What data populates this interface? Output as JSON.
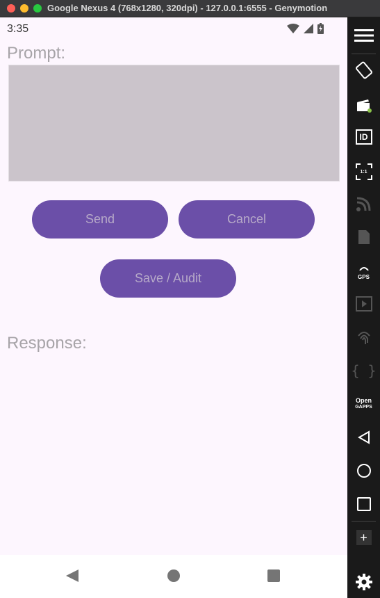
{
  "window": {
    "title": "Google Nexus 4 (768x1280, 320dpi) - 127.0.0.1:6555 - Genymotion"
  },
  "status_bar": {
    "time": "3:35"
  },
  "prompt": {
    "label": "Prompt:",
    "value": ""
  },
  "buttons": {
    "send": "Send",
    "cancel": "Cancel",
    "save_audit": "Save / Audit"
  },
  "response": {
    "label": "Response:",
    "value": ""
  },
  "sidebar": {
    "items": [
      {
        "icon": "menu-icon"
      },
      {
        "icon": "rotate-icon"
      },
      {
        "icon": "camera-clapper-icon"
      },
      {
        "icon": "id-icon",
        "text": "ID"
      },
      {
        "icon": "pixel-perfect-icon",
        "text": "1:1"
      },
      {
        "icon": "cast-icon"
      },
      {
        "icon": "sim-card-icon"
      },
      {
        "icon": "gps-icon",
        "text": "GPS"
      },
      {
        "icon": "media-icon"
      },
      {
        "icon": "fingerprint-icon"
      },
      {
        "icon": "braces-icon",
        "text": "{ }"
      },
      {
        "icon": "open-gapps-icon",
        "text": "Open",
        "text2": "GAPPS"
      },
      {
        "icon": "back-icon"
      },
      {
        "icon": "home-icon"
      },
      {
        "icon": "recents-icon"
      },
      {
        "icon": "plus-icon",
        "text": "+"
      },
      {
        "icon": "settings-icon"
      }
    ]
  },
  "colors": {
    "screen_bg": "#fdf6fe",
    "button_bg": "#6b4fa8",
    "button_text": "#b6a9c8",
    "prompt_box": "#cbc4cb",
    "sidebar_bg": "#1a1a1a"
  }
}
